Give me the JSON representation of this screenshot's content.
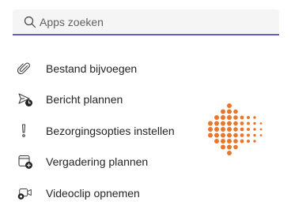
{
  "search": {
    "placeholder": "Apps zoeken",
    "icon": "search-icon"
  },
  "menu": {
    "items": [
      {
        "label": "Bestand bijvoegen",
        "icon": "paperclip-icon"
      },
      {
        "label": "Bericht plannen",
        "icon": "send-clock-icon"
      },
      {
        "label": "Bezorgingsopties instellen",
        "icon": "exclamation-icon"
      },
      {
        "label": "Vergadering plannen",
        "icon": "calendar-add-icon"
      },
      {
        "label": "Videoclip opnemen",
        "icon": "video-clip-icon"
      }
    ]
  },
  "decoration": {
    "icon": "dotted-arrow-icon",
    "color": "#e8772e"
  },
  "colors": {
    "accent": "#5b5fc7",
    "text": "#242424",
    "search_bg": "#f5f5f5"
  }
}
